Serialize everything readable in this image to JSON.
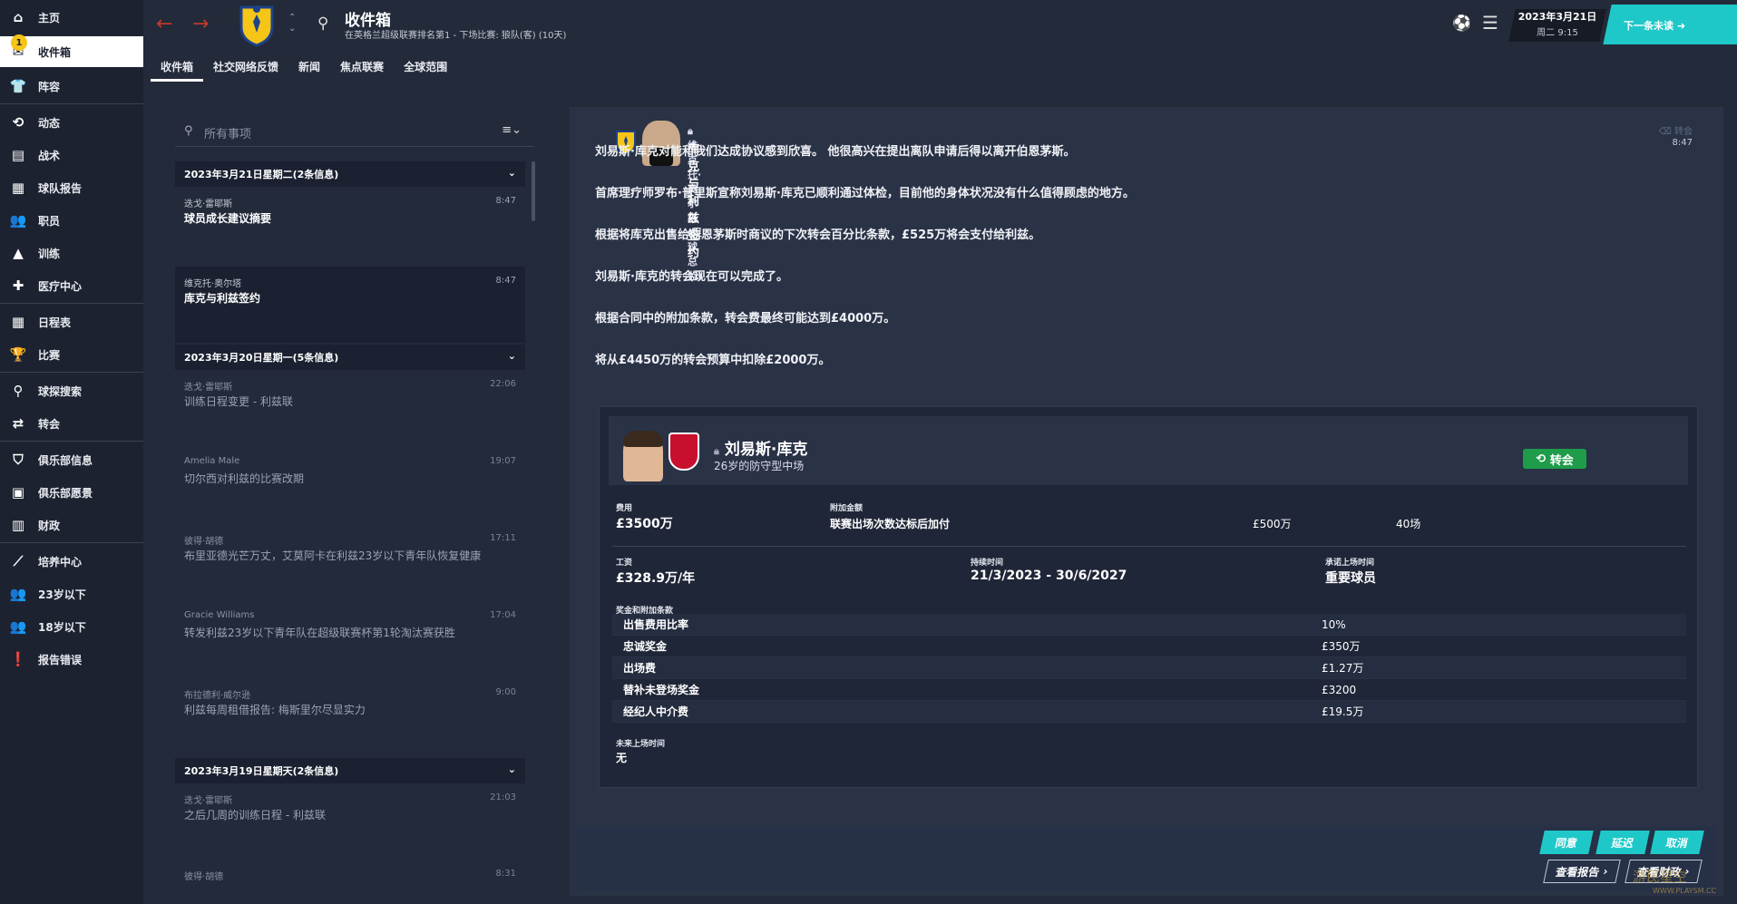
{
  "sidebar": {
    "items": [
      {
        "label": "主页",
        "icon": "home-icon"
      },
      {
        "label": "收件箱",
        "icon": "inbox-icon",
        "badge": "1"
      },
      {
        "label": "阵容",
        "icon": "shirt-icon"
      },
      {
        "label": "动态",
        "icon": "dynamics-icon"
      },
      {
        "label": "战术",
        "icon": "tactics-icon"
      },
      {
        "label": "球队报告",
        "icon": "report-icon"
      },
      {
        "label": "职员",
        "icon": "staff-icon"
      },
      {
        "label": "训练",
        "icon": "training-icon"
      },
      {
        "label": "医疗中心",
        "icon": "medical-icon"
      },
      {
        "label": "日程表",
        "icon": "calendar-icon"
      },
      {
        "label": "比赛",
        "icon": "trophy-icon"
      },
      {
        "label": "球探搜索",
        "icon": "search-icon"
      },
      {
        "label": "转会",
        "icon": "transfer-icon"
      },
      {
        "label": "俱乐部信息",
        "icon": "shield-icon"
      },
      {
        "label": "俱乐部愿景",
        "icon": "vision-icon"
      },
      {
        "label": "财政",
        "icon": "finance-icon"
      },
      {
        "label": "培养中心",
        "icon": "development-icon"
      },
      {
        "label": "23岁以下",
        "icon": "u23-icon"
      },
      {
        "label": "18岁以下",
        "icon": "u18-icon"
      },
      {
        "label": "报告错误",
        "icon": "error-icon"
      }
    ]
  },
  "header": {
    "title": "收件箱",
    "subtitle": "在英格兰超级联赛排名第1 - 下场比赛: 狼队(客) (10天)",
    "date": "2023年3月21日",
    "weekday_time": "周二 9:15",
    "next_label": "下一条未读"
  },
  "tabs": [
    "收件箱",
    "社交网络反馈",
    "新闻",
    "焦点联赛",
    "全球范围"
  ],
  "search": {
    "placeholder": "所有事项"
  },
  "groups": [
    {
      "label": "2023年3月21日星期二(2条信息)"
    },
    {
      "label": "2023年3月20日星期一(5条信息)"
    },
    {
      "label": "2023年3月19日星期天(2条信息)"
    }
  ],
  "messages": [
    {
      "sender": "迭戈·雷耶斯",
      "time": "8:47",
      "subject": "球员成长建议摘要"
    },
    {
      "sender": "维克托·奥尔塔",
      "time": "8:47",
      "subject": "库克与利兹签约"
    },
    {
      "sender": "迭戈·雷耶斯",
      "time": "22:06",
      "subject": "训练日程变更 - 利兹联"
    },
    {
      "sender": "Amelia Male",
      "time": "19:07",
      "subject": "切尔西对利兹的比赛改期"
    },
    {
      "sender": "彼得·胡德",
      "time": "17:11",
      "subject": "布里亚德光芒万丈，艾莫阿卡在利兹23岁以下青年队恢复健康"
    },
    {
      "sender": "Gracie Williams",
      "time": "17:04",
      "subject": "转发利兹23岁以下青年队在超级联赛杯第1轮淘汰赛获胜"
    },
    {
      "sender": "布拉德利·威尔逊",
      "time": "9:00",
      "subject": "利兹每周租借报告: 梅斯里尔尽显实力"
    },
    {
      "sender": "迭戈·雷耶斯",
      "time": "21:03",
      "subject": "之后几周的训练日程 - 利兹联"
    },
    {
      "sender": "彼得·胡德",
      "time": "8:31",
      "subject": ""
    }
  ],
  "detail": {
    "sender": "维克托·奥尔塔 (足球总监)",
    "subject": "库克与利兹签约",
    "tag": "转会",
    "time": "8:47",
    "paragraphs": [
      "刘易斯·库克对能和我们达成协议感到欣喜。 他很高兴在提出离队申请后得以离开伯恩茅斯。",
      "首席理疗师罗布·普里斯宣称刘易斯·库克已顺利通过体检，目前他的身体状况没有什么值得顾虑的地方。",
      "根据将库克出售给伯恩茅斯时商议的下次转会百分比条款，£525万将会支付给利兹。",
      "刘易斯·库克的转会现在可以完成了。",
      "根据合同中的附加条款，转会费最终可能达到£4000万。",
      "将从£4450万的转会预算中扣除£2000万。"
    ]
  },
  "card": {
    "player_name": "刘易斯·库克",
    "player_desc": "26岁的防守型中场",
    "transfer_label": "转会",
    "fee_label": "费用",
    "fee": "£3500万",
    "addon_label": "附加金额",
    "addon_desc": "联赛出场次数达标后加付",
    "addon_amount": "£500万",
    "addon_apps": "40场",
    "wage_label": "工资",
    "wage": "£328.9万/年",
    "duration_label": "持续时间",
    "duration": "21/3/2023 - 30/6/2027",
    "promise_label": "承诺上场时间",
    "promise": "重要球员",
    "bonus_label": "奖金和附加条款",
    "bonuses": [
      {
        "label": "出售费用比率",
        "value": "10%"
      },
      {
        "label": "忠诚奖金",
        "value": "£350万"
      },
      {
        "label": "出场费",
        "value": "£1.27万"
      },
      {
        "label": "替补未登场奖金",
        "value": "£3200"
      },
      {
        "label": "经纪人中介费",
        "value": "£19.5万"
      }
    ],
    "future_label": "未来上场时间",
    "future": "无"
  },
  "footer": {
    "agree": "同意",
    "delay": "延迟",
    "cancel": "取消",
    "view_report": "查看报告",
    "view_finance": "查看财政"
  },
  "watermark": "游民星空",
  "watermark_url": "WWW.PLAYSM.CC",
  "colors": {
    "accent": "#1fc8c8",
    "transfer_green": "#1e9c4a",
    "badge": "#f5c518"
  }
}
